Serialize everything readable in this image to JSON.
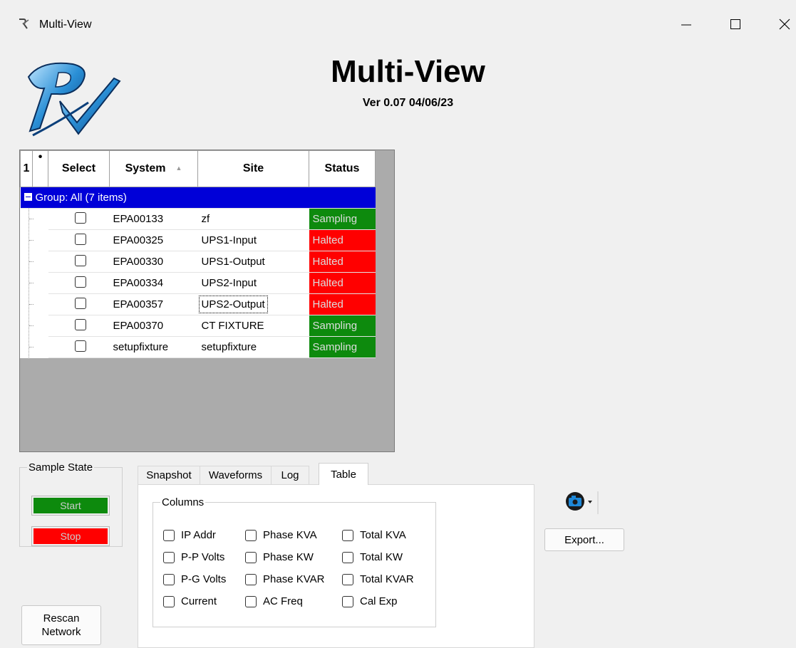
{
  "window": {
    "title": "Multi-View",
    "icon": "rx-app-icon",
    "controls": [
      "minimize-icon",
      "maximize-icon",
      "close-icon"
    ]
  },
  "header": {
    "logo": "rx-logo",
    "title": "Multi-View",
    "version": "Ver 0.07 04/06/23"
  },
  "grid": {
    "columns": {
      "num": "1",
      "dot": "•",
      "select": "Select",
      "system": "System",
      "site": "Site",
      "status": "Status"
    },
    "sort_indicator": "▲",
    "group_label": "Group: All (7 items)",
    "rows": [
      {
        "system": "EPA00133",
        "site": "zf",
        "status": "Sampling"
      },
      {
        "system": "EPA00325",
        "site": "UPS1-Input",
        "status": "Halted"
      },
      {
        "system": "EPA00330",
        "site": "UPS1-Output",
        "status": "Halted"
      },
      {
        "system": "EPA00334",
        "site": "UPS2-Input",
        "status": "Halted"
      },
      {
        "system": "EPA00357",
        "site": "UPS2-Output",
        "status": "Halted"
      },
      {
        "system": "EPA00370",
        "site": "CT FIXTURE",
        "status": "Sampling"
      },
      {
        "system": "setupfixture",
        "site": "setupfixture",
        "status": "Sampling"
      }
    ],
    "status_colors": {
      "Sampling": "#0d8a0d",
      "Halted": "#ff0000"
    },
    "group_color": "#0000d8"
  },
  "sample_state": {
    "legend": "Sample State",
    "start_label": "Start",
    "stop_label": "Stop",
    "start_color": "#0d8a0d",
    "stop_color": "#ff0000"
  },
  "rescan": {
    "line1": "Rescan",
    "line2": "Network"
  },
  "tabs": [
    "Snapshot",
    "Waveforms",
    "Log",
    "Table"
  ],
  "active_tab": "Table",
  "columns_group": {
    "legend": "Columns",
    "options": [
      [
        "IP Addr",
        "Phase KVA",
        "Total KVA"
      ],
      [
        "P-P Volts",
        "Phase KW",
        "Total KW"
      ],
      [
        "P-G Volts",
        "Phase KVAR",
        "Total KVAR"
      ],
      [
        "Current",
        "AC Freq",
        "Cal Exp"
      ]
    ]
  },
  "toolbar": {
    "camera_icon": "camera-icon",
    "export_label": "Export..."
  }
}
